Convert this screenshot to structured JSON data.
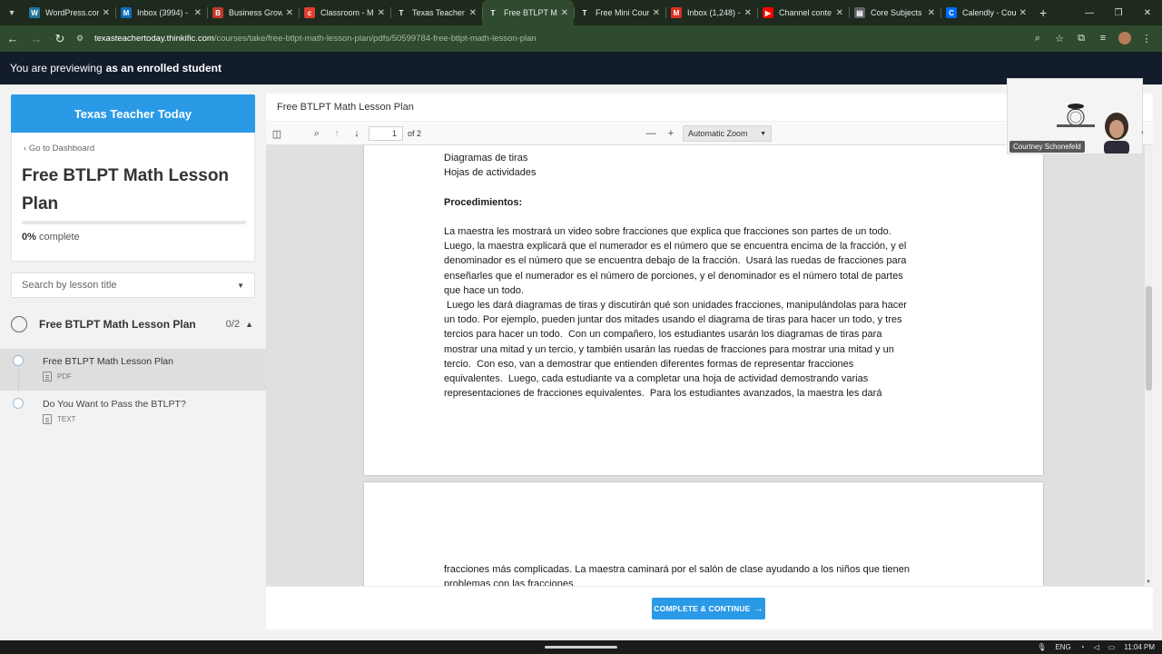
{
  "browser": {
    "tabs": [
      {
        "title": "WordPress.com",
        "favicon": "wordpress-icon",
        "color": "#21759b",
        "glyph": "W"
      },
      {
        "title": "Inbox (3994) -",
        "favicon": "outlook-icon",
        "color": "#0f6cbd",
        "glyph": "M"
      },
      {
        "title": "Business Growth",
        "favicon": "business-icon",
        "color": "#c0392b",
        "glyph": "B"
      },
      {
        "title": "Classroom - M",
        "favicon": "classroom-icon",
        "color": "#e0402f",
        "glyph": "c"
      },
      {
        "title": "Texas Teacher",
        "favicon": "thinkific-icon",
        "color": "#1e2a1e",
        "glyph": "T"
      },
      {
        "title": "Free BTLPT Ma",
        "favicon": "thinkific-icon",
        "color": "#2f4a2f",
        "glyph": "T"
      },
      {
        "title": "Free Mini Cour",
        "favicon": "thinkific-icon",
        "color": "#1e2a1e",
        "glyph": "T"
      },
      {
        "title": "Inbox (1,248) -",
        "favicon": "gmail-icon",
        "color": "#d93025",
        "glyph": "M"
      },
      {
        "title": "Channel conte",
        "favicon": "youtube-icon",
        "color": "#ff0000",
        "glyph": "▶"
      },
      {
        "title": "Core Subjects",
        "favicon": "doc-icon",
        "color": "#5f6368",
        "glyph": "▤"
      },
      {
        "title": "Calendly - Cou",
        "favicon": "calendly-icon",
        "color": "#006bff",
        "glyph": "C"
      }
    ],
    "active_tab_index": 5,
    "url_host": "texasteachertoday.thinkific.com",
    "url_path": "/courses/take/free-btlpt-math-lesson-plan/pdfs/50599784-free-btlpt-math-lesson-plan"
  },
  "preview_bar": {
    "prefix": "You are previewing",
    "emphasis": "as an enrolled student"
  },
  "sidebar": {
    "brand": "Texas Teacher Today",
    "back_link": "Go to Dashboard",
    "course_title": "Free BTLPT Math Lesson Plan",
    "progress_percent": 0,
    "progress_value": "0%",
    "progress_label": "complete",
    "search_placeholder": "Search by lesson title",
    "chapter": {
      "title": "Free BTLPT Math Lesson Plan",
      "count": "0/2"
    },
    "lessons": [
      {
        "title": "Free BTLPT Math Lesson Plan",
        "type": "PDF",
        "active": true
      },
      {
        "title": "Do You Want to Pass the BTLPT?",
        "type": "TEXT",
        "active": false
      }
    ]
  },
  "main": {
    "header_title": "Free BTLPT Math Lesson Plan",
    "complete_button": "COMPLETE & CONTINUE",
    "pdf": {
      "page_number": "1",
      "page_count": "of 2",
      "zoom": "Automatic Zoom",
      "page1_lines": [
        {
          "text": "Diagramas de tiras",
          "bold": false
        },
        {
          "text": "Hojas de actividades",
          "bold": false
        },
        {
          "text": "",
          "bold": false
        },
        {
          "text": "Procedimientos:",
          "bold": true
        },
        {
          "text": "",
          "bold": false
        },
        {
          "text": "La maestra les mostrará un video sobre fracciones que explica que fracciones son partes de un todo.",
          "bold": false
        },
        {
          "text": "Luego, la maestra explicará que el numerador es el número que se encuentra encima de la fracción, y el",
          "bold": false
        },
        {
          "text": "denominador es el número que se encuentra debajo de la fracción.  Usará las ruedas de fracciones para",
          "bold": false
        },
        {
          "text": "enseñarles que el numerador es el número de porciones, y el denominador es el número total de partes",
          "bold": false
        },
        {
          "text": "que hace un todo.",
          "bold": false
        },
        {
          "text": " Luego les dará diagramas de tiras y discutirán qué son unidades fracciones, manipulándolas para hacer",
          "bold": false
        },
        {
          "text": "un todo. Por ejemplo, pueden juntar dos mitades usando el diagrama de tiras para hacer un todo, y tres",
          "bold": false
        },
        {
          "text": "tercios para hacer un todo.  Con un compañero, los estudiantes usarán los diagramas de tiras para",
          "bold": false
        },
        {
          "text": "mostrar una mitad y un tercio, y también usarán las ruedas de fracciones para mostrar una mitad y un",
          "bold": false
        },
        {
          "text": "tercio.  Con eso, van a demostrar que entienden diferentes formas de representar fracciones",
          "bold": false
        },
        {
          "text": "equivalentes.  Luego, cada estudiante va a completar una hoja de actividad demostrando varias",
          "bold": false
        },
        {
          "text": "representaciones de fracciones equivalentes.  Para los estudiantes avanzados, la maestra les dará",
          "bold": false
        }
      ],
      "page2_lines": [
        "fracciones más complicadas. La maestra caminará por el salón de clase ayudando a los niños que tienen",
        "problemas con las fracciones."
      ]
    }
  },
  "webcam": {
    "name": "Courtney Schonefeld"
  },
  "taskbar": {
    "lang": "ENG",
    "time": "11:04 PM"
  },
  "colors": {
    "accent": "#2b9ae6",
    "preview_bar": "#131c2b",
    "browser_frame": "#2f4a2f"
  }
}
